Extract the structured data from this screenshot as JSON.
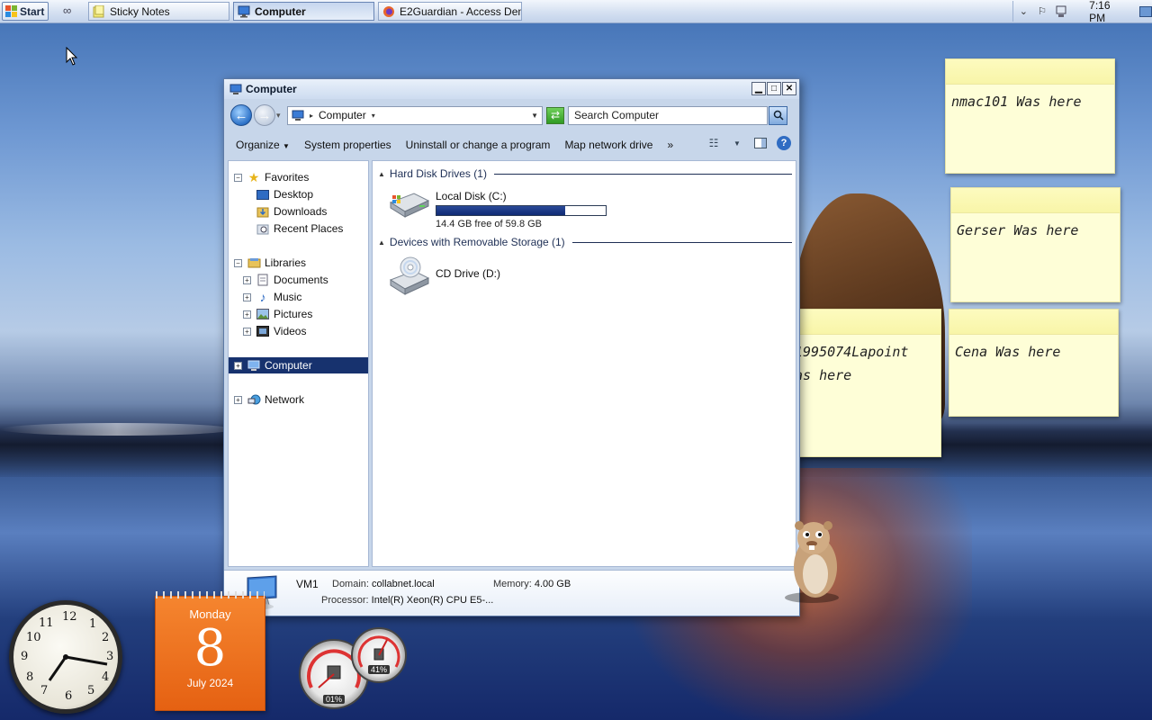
{
  "taskbar": {
    "start_label": "Start",
    "tasks": [
      {
        "label": "Sticky Notes"
      },
      {
        "label": "Computer"
      },
      {
        "label": "E2Guardian - Access Den..."
      }
    ],
    "clock": "7:16 PM"
  },
  "sticky_notes": [
    {
      "text": "nmac101 Was here"
    },
    {
      "text": "Gerser Was here"
    },
    {
      "text_line1": "1995074Lapoint",
      "text_line2": "as here"
    },
    {
      "text": "Cena Was here"
    }
  ],
  "window": {
    "title": "Computer",
    "address": "Computer",
    "search_placeholder": "Search Computer",
    "commands": [
      "Organize",
      "System properties",
      "Uninstall or change a program",
      "Map network drive",
      "»"
    ],
    "nav": {
      "favorites": "Favorites",
      "desktop": "Desktop",
      "downloads": "Downloads",
      "recent_places": "Recent Places",
      "libraries": "Libraries",
      "documents": "Documents",
      "music": "Music",
      "pictures": "Pictures",
      "videos": "Videos",
      "computer": "Computer",
      "network": "Network"
    },
    "groups": {
      "hdd_header": "Hard Disk Drives (1)",
      "removable_header": "Devices with Removable Storage (1)"
    },
    "drives": {
      "local_name": "Local Disk (C:)",
      "local_free": "14.4 GB free of 59.8 GB",
      "local_used_fraction": 0.759,
      "cd_name": "CD Drive (D:)"
    },
    "details": {
      "computer_name": "VM1",
      "domain_label": "Domain:",
      "domain_value": "collabnet.local",
      "memory_label": "Memory:",
      "memory_value": "4.00 GB",
      "processor_label": "Processor:",
      "processor_value": "Intel(R) Xeon(R) CPU E5-..."
    }
  },
  "gadgets": {
    "calendar": {
      "weekday": "Monday",
      "day": "8",
      "month_year": "July 2024"
    },
    "cpu_meter": {
      "cpu": "01%",
      "memory": "41%"
    }
  }
}
